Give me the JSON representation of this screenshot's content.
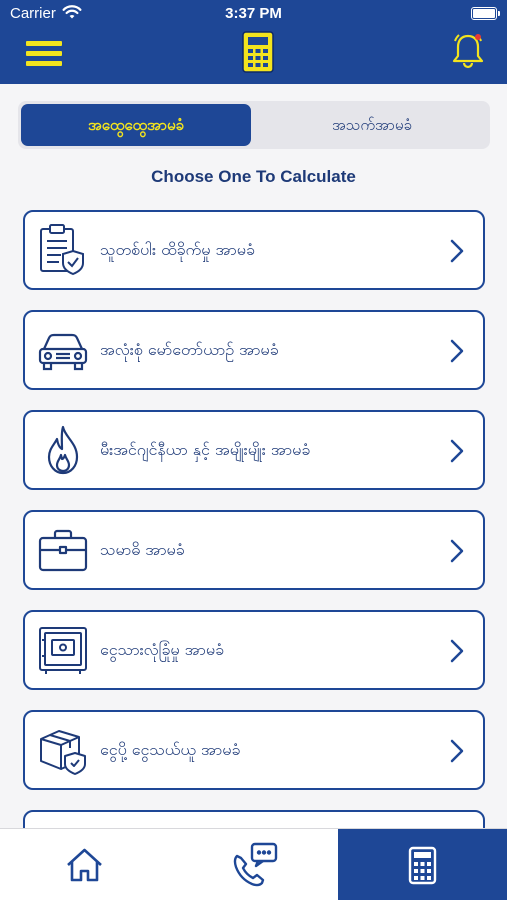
{
  "status_bar": {
    "carrier": "Carrier",
    "time": "3:37 PM"
  },
  "nav": {
    "menu_icon": "menu-icon",
    "logo_icon": "calculator-icon",
    "bell_icon": "bell-icon"
  },
  "tabs_top": {
    "active_label": "အထွေထွေအာမခံ",
    "inactive_label": "အသက်အာမခံ"
  },
  "section_title": "Choose One To Calculate",
  "cards": [
    {
      "label": "သူတစ်ပါး ထိခိုက်မှု အာမခံ",
      "icon": "clipboard-shield-icon"
    },
    {
      "label": "အလုံးစုံ မော်တော်ယာဥ် အာမခံ",
      "icon": "car-icon"
    },
    {
      "label": "မီးအင်ဂျင်နီယာ နှင့် အမျိုးမျိုး အာမခံ",
      "icon": "fire-icon"
    },
    {
      "label": "သမာဓိ အာမခံ",
      "icon": "briefcase-icon"
    },
    {
      "label": "ငွေသားလုံခြုံမှု အာမခံ",
      "icon": "safe-icon"
    },
    {
      "label": "ငွေပို့ ငွေသယ်ယူ အာမခံ",
      "icon": "box-shield-icon"
    }
  ],
  "bottom_tabs": [
    {
      "icon": "home-icon",
      "active": false
    },
    {
      "icon": "phone-chat-icon",
      "active": false
    },
    {
      "icon": "calculator-icon",
      "active": true
    }
  ],
  "colors": {
    "brand_blue": "#1e4796",
    "accent_yellow": "#f3e41e",
    "text_blue": "#1e3a78"
  }
}
